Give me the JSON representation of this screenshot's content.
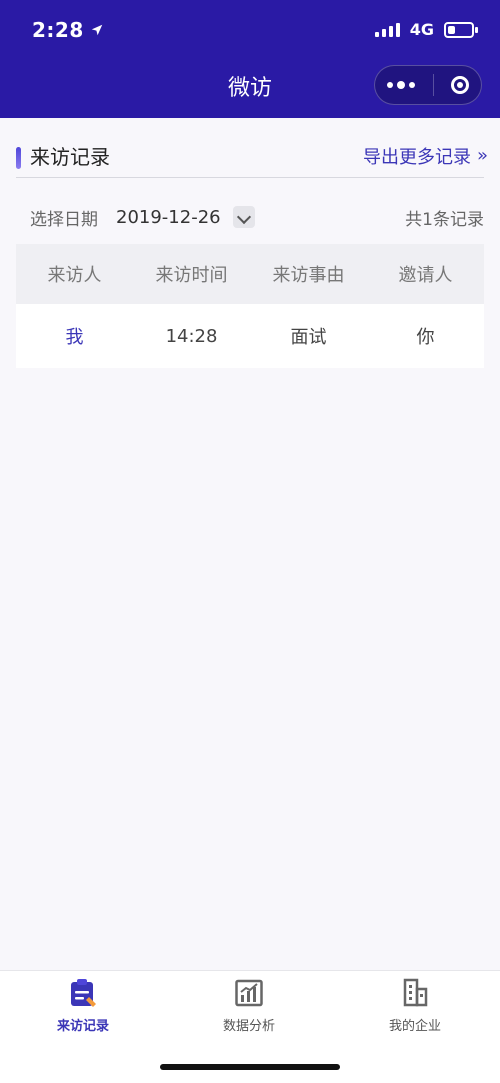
{
  "status_bar": {
    "time": "2:28",
    "network": "4G"
  },
  "nav": {
    "title": "微访"
  },
  "section": {
    "title": "来访记录",
    "export_label": "导出更多记录",
    "export_chevrons": "»"
  },
  "filter": {
    "label": "选择日期",
    "date": "2019-12-26",
    "total": "共1条记录"
  },
  "table": {
    "headers": [
      "来访人",
      "来访时间",
      "来访事由",
      "邀请人"
    ],
    "rows": [
      [
        "我",
        "14:28",
        "面试",
        "你"
      ]
    ]
  },
  "tabbar": {
    "items": [
      {
        "label": "来访记录",
        "icon": "visit-record-icon"
      },
      {
        "label": "数据分析",
        "icon": "data-analysis-icon"
      },
      {
        "label": "我的企业",
        "icon": "my-company-icon"
      }
    ]
  },
  "colors": {
    "primary": "#2a1aa5",
    "accent": "#3b36b7"
  }
}
